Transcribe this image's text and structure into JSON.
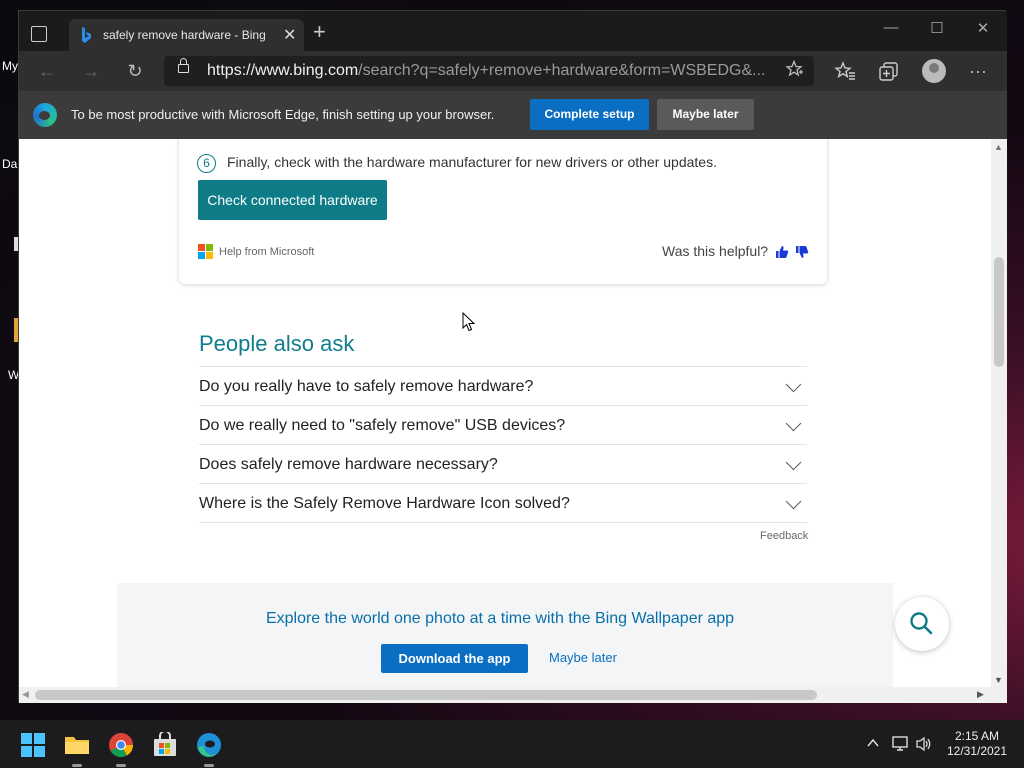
{
  "desktop": {
    "labels": [
      "My",
      "Da",
      "W"
    ]
  },
  "browser": {
    "tab": {
      "title": "safely remove hardware - Bing",
      "close": "✕"
    },
    "new_tab": "+",
    "window_controls": {
      "minimize": "—",
      "maximize": "☐",
      "close": "✕"
    },
    "nav": {
      "back": "←",
      "forward": "→",
      "refresh": "↻",
      "more": "···"
    },
    "address": {
      "host": "https://www.bing.com",
      "rest": "/search?q=safely+remove+hardware&form=WSBEDG&..."
    },
    "infobar": {
      "message": "To be most productive with Microsoft Edge, finish setting up your browser.",
      "complete_label": "Complete setup",
      "later_label": "Maybe later"
    }
  },
  "page": {
    "card": {
      "step_number": "6",
      "step_text": "Finally, check with the hardware manufacturer for new drivers or other updates.",
      "button_label": "Check connected hardware",
      "help_text": "Help from Microsoft",
      "helpful_text": "Was this helpful?"
    },
    "people_also_ask": {
      "title": "People also ask",
      "questions": [
        "Do you really have to safely remove hardware?",
        "Do we really need to \"safely remove\" USB devices?",
        "Does safely remove hardware necessary?",
        "Where is the Safely Remove Hardware Icon solved?"
      ],
      "feedback": "Feedback"
    },
    "promo": {
      "text": "Explore the world one photo at a time with the Bing Wallpaper app",
      "download_label": "Download the app",
      "later_label": "Maybe later"
    }
  },
  "taskbar": {
    "time": "2:15 AM",
    "date": "12/31/2021"
  },
  "colors": {
    "accent_teal": "#0d7c87",
    "bing_blue": "#0a6fc2",
    "taskbar": "#1c1c1e"
  }
}
